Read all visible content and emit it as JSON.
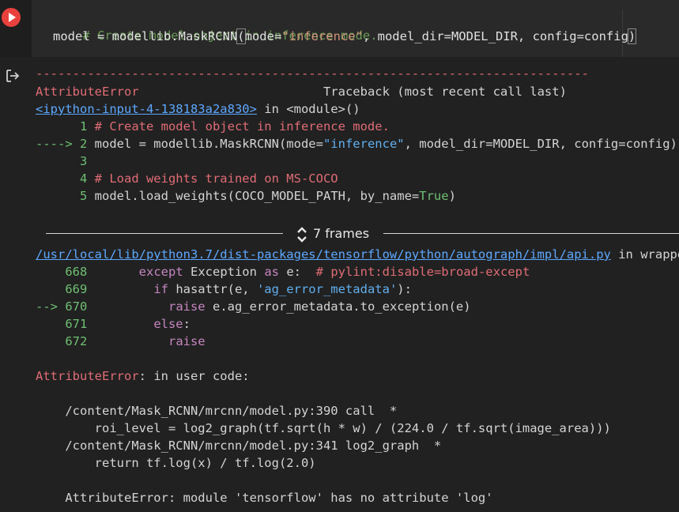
{
  "cell": {
    "run_icon": "play-icon",
    "code": {
      "line1": "# Create model object in inference mode.",
      "line2_a": "model = modellib.MaskRCNN",
      "line2_paren_open": "(",
      "line2_b": "mode=",
      "line2_str": "\"inference\"",
      "line2_c": ", model_dir=MODEL_DIR, config=config",
      "line2_paren_close": ")"
    }
  },
  "output": {
    "icon": "output-redirect-icon",
    "dashes": "---------------------------------------------------------------------------",
    "error_name": "AttributeError",
    "traceback_label": "Traceback (most recent call last)",
    "input_link": "<ipython-input-4-138183a2a830>",
    "in_module": " in <module>()",
    "src": [
      {
        "prefix": "      1 ",
        "text": "# Create model object in inference mode."
      },
      {
        "prefix": "----> 2 ",
        "a": "model = modellib.MaskRCNN(mode=",
        "s": "\"inference\"",
        "b": ", model_dir=MODEL_DIR, config=config)"
      },
      {
        "prefix": "      3"
      },
      {
        "prefix": "      4 ",
        "text": "# Load weights trained on MS-COCO"
      },
      {
        "prefix": "      5 ",
        "a": "model.load_weights(COCO_MODEL_PATH, by_name=",
        "k": "True",
        "b": ")"
      }
    ],
    "frames_label": "7 frames",
    "frames_icon": "unfold-icon",
    "api_link": "/usr/local/lib/python3.7/dist-packages/tensorflow/python/autograph/impl/api.py",
    "in_wrapper": " in wrapper(*",
    "api_lines": [
      {
        "num": "    668 ",
        "kw": "except",
        "a": " Exception ",
        "kw2": "as",
        "b": " e:  ",
        "c": "# pylint:disable=broad-except"
      },
      {
        "num": "    669 ",
        "kw": "if",
        "a": " hasattr(e, ",
        "s": "'ag_error_metadata'",
        "b": "):"
      },
      {
        "num": "--> 670 ",
        "kw": "raise",
        "a": " e.ag_error_metadata.to_exception(e)"
      },
      {
        "num": "    671 ",
        "kw": "else",
        "a": ":"
      },
      {
        "num": "    672 ",
        "kw": "raise"
      }
    ],
    "user_code_err": "AttributeError",
    "user_code_msg": ": in user code:",
    "trace": [
      "    /content/Mask_RCNN/mrcnn/model.py:390 call  *",
      "        roi_level = log2_graph(tf.sqrt(h * w) / (224.0 / tf.sqrt(image_area)))",
      "    /content/Mask_RCNN/mrcnn/model.py:341 log2_graph  *",
      "        return tf.log(x) / tf.log(2.0)",
      "",
      "    AttributeError: module 'tensorflow' has no attribute 'log'"
    ]
  }
}
